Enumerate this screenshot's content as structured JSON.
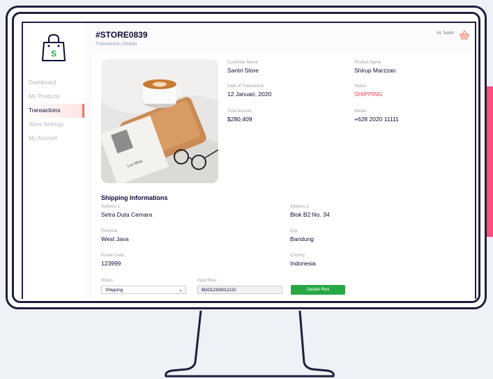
{
  "header": {
    "store_id": "#STORE0839",
    "subtitle": "Transaction Details",
    "greeting": "Hi, Santri"
  },
  "sidebar": {
    "logo_letter": "S",
    "items": [
      {
        "label": "Dashboard",
        "active": false
      },
      {
        "label": "My Products",
        "active": false
      },
      {
        "label": "Transactions",
        "active": true
      },
      {
        "label": "Store Settings",
        "active": false
      },
      {
        "label": "My Account",
        "active": false
      }
    ]
  },
  "transaction": {
    "customer_name_label": "Customer Name",
    "customer_name": "Santri Store",
    "product_name_label": "Product Name",
    "product_name": "Shirup Marzzan",
    "date_label": "Date of Transaction",
    "date": "12 Januari, 2020",
    "status_label": "Status",
    "status": "SHIPPING",
    "total_label": "Total Amount",
    "total": "$280,409",
    "mobile_label": "Mobile",
    "mobile": "+628 2020 11111"
  },
  "shipping": {
    "title": "Shipping Informations",
    "address1_label": "Address 1",
    "address1": "Setra Duta Cemara",
    "address2_label": "Address 2",
    "address2": "Blok B2 No. 34",
    "province_label": "Province",
    "province": "West Java",
    "city_label": "City",
    "city": "Bandung",
    "postal_label": "Postal Code",
    "postal": "123999",
    "country_label": "Country",
    "country": "Indonesia",
    "status_field_label": "Status",
    "status_value": "Shipping",
    "resi_label": "Input Resi",
    "resi_value": "BDO12308012132",
    "update_button": "Update Resi"
  },
  "colors": {
    "accent": "#ff4f7b",
    "status_shipping": "#ff3a4c",
    "button_green": "#27a844",
    "frame": "#1e1f3d",
    "text_primary": "#0c0d36"
  },
  "icons": {
    "logo": "shopping-bag-icon",
    "cart": "basket-icon",
    "dropdown": "chevron-down-icon"
  }
}
